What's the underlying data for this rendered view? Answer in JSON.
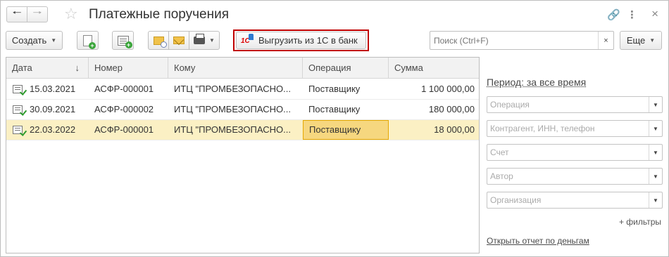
{
  "window": {
    "title": "Платежные поручения"
  },
  "toolbar": {
    "create_label": "Создать",
    "export_label": "Выгрузить из 1С в банк",
    "more_label": "Еще",
    "search_placeholder": "Поиск (Ctrl+F)",
    "clear_symbol": "×"
  },
  "table": {
    "columns": [
      "Дата",
      "Номер",
      "Кому",
      "Операция",
      "Сумма"
    ],
    "sort_indicator": "↓",
    "rows": [
      {
        "date": "15.03.2021",
        "number": "АСФР-000001",
        "to": "ИТЦ \"ПРОМБЕЗОПАСНО...",
        "operation": "Поставщику",
        "amount": "1 100 000,00"
      },
      {
        "date": "30.09.2021",
        "number": "АСФР-000002",
        "to": "ИТЦ \"ПРОМБЕЗОПАСНО...",
        "operation": "Поставщику",
        "amount": "180 000,00"
      },
      {
        "date": "22.03.2022",
        "number": "АСФР-000001",
        "to": "ИТЦ \"ПРОМБЕЗОПАСНО...",
        "operation": "Поставщику",
        "amount": "18 000,00"
      }
    ],
    "selected_row": 2
  },
  "filters": {
    "period_label": "Период: за все время",
    "fields": [
      {
        "placeholder": "Операция"
      },
      {
        "placeholder": "Контрагент, ИНН, телефон"
      },
      {
        "placeholder": "Счет"
      },
      {
        "placeholder": "Автор"
      },
      {
        "placeholder": "Организация"
      }
    ],
    "more_filters_label": "+ фильтры",
    "report_link_label": "Открыть отчет по деньгам"
  },
  "colors": {
    "selected_row_bg": "#fbf0c4",
    "active_cell_bg": "#f6d77f",
    "highlight_border": "#c00000"
  }
}
